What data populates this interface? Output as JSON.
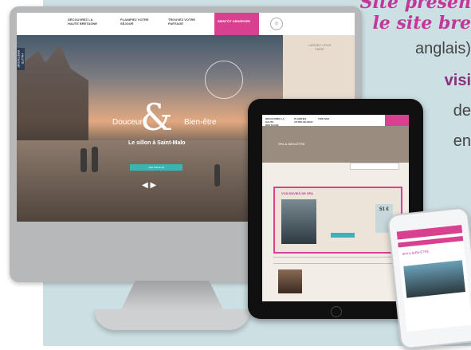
{
  "promo_text": {
    "line1": "Site présen",
    "line2": "le site bre",
    "line3": "anglais)",
    "line4": "visi",
    "line5": "de",
    "line6": "en"
  },
  "desktop_site": {
    "nav": [
      "DÉCOUVREZ LA HAUTE BRETAGNE",
      "PLANIFIEZ VOTRE SÉJOUR",
      "TROUVEZ VOTRE PARTAGE",
      "BIENTÔT OBSERVER"
    ],
    "side_badge": "HAUTE BRETAGNE",
    "hero_word_left": "Douceur",
    "hero_word_right": "Bien-être",
    "hero_amp": "&",
    "hero_subtitle": "Le sillon à Saint-Malo",
    "cta_label": "J'EN PROFITE",
    "promo_label": "LAISSEZ VOUS FAIRE",
    "arrows": "◀ ▶"
  },
  "tablet_site": {
    "nav": [
      "DÉCOUVREZ LA HAUTE BRETAGNE",
      "PLANIFIEZ VOTRE SÉJOUR",
      "TROUVEZ"
    ],
    "band_text": "SPA & BIEN-ÊTRE",
    "card_head": "VOS ENVIES DE SPA",
    "price": "51 €"
  },
  "phone_site": {
    "title": "SPA & BIEN-ÊTRE"
  },
  "colors": {
    "accent_pink": "#d9408f",
    "accent_purple": "#8a2e7f",
    "teal": "#3bb3b5",
    "background": "#ccdfe3"
  }
}
